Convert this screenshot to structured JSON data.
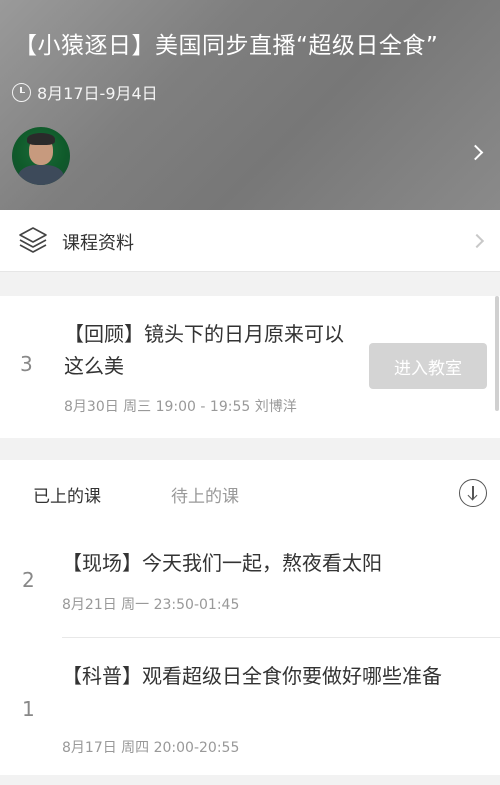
{
  "header": {
    "title": "【小猿逐日】美国同步直播“超级日全食”",
    "date_range": "8月17日-9月4日"
  },
  "materials": {
    "label": "课程资料"
  },
  "live_lesson": {
    "index": "3",
    "title": "【回顾】镜头下的日月原来可以这么美",
    "meta": "8月30日  周三 19:00 - 19:55 刘博洋",
    "button_label": "进入教室"
  },
  "tabs": {
    "done": "已上的课",
    "pending": "待上的课"
  },
  "lessons": [
    {
      "index": "2",
      "title": "【现场】今天我们一起，熬夜看太阳",
      "meta": "8月21日  周一  23:50-01:45"
    },
    {
      "index": "1",
      "title": "【科普】观看超级日全食你要做好哪些准备",
      "meta": "8月17日  周四  20:00-20:55"
    }
  ],
  "icons": {
    "clock": "clock-icon",
    "chevron": "chevron-right-icon",
    "layers": "layers-icon",
    "download": "download-icon"
  },
  "colors": {
    "button_disabled": "#d4d4d4",
    "text_primary": "#333333",
    "text_muted": "#999999"
  }
}
